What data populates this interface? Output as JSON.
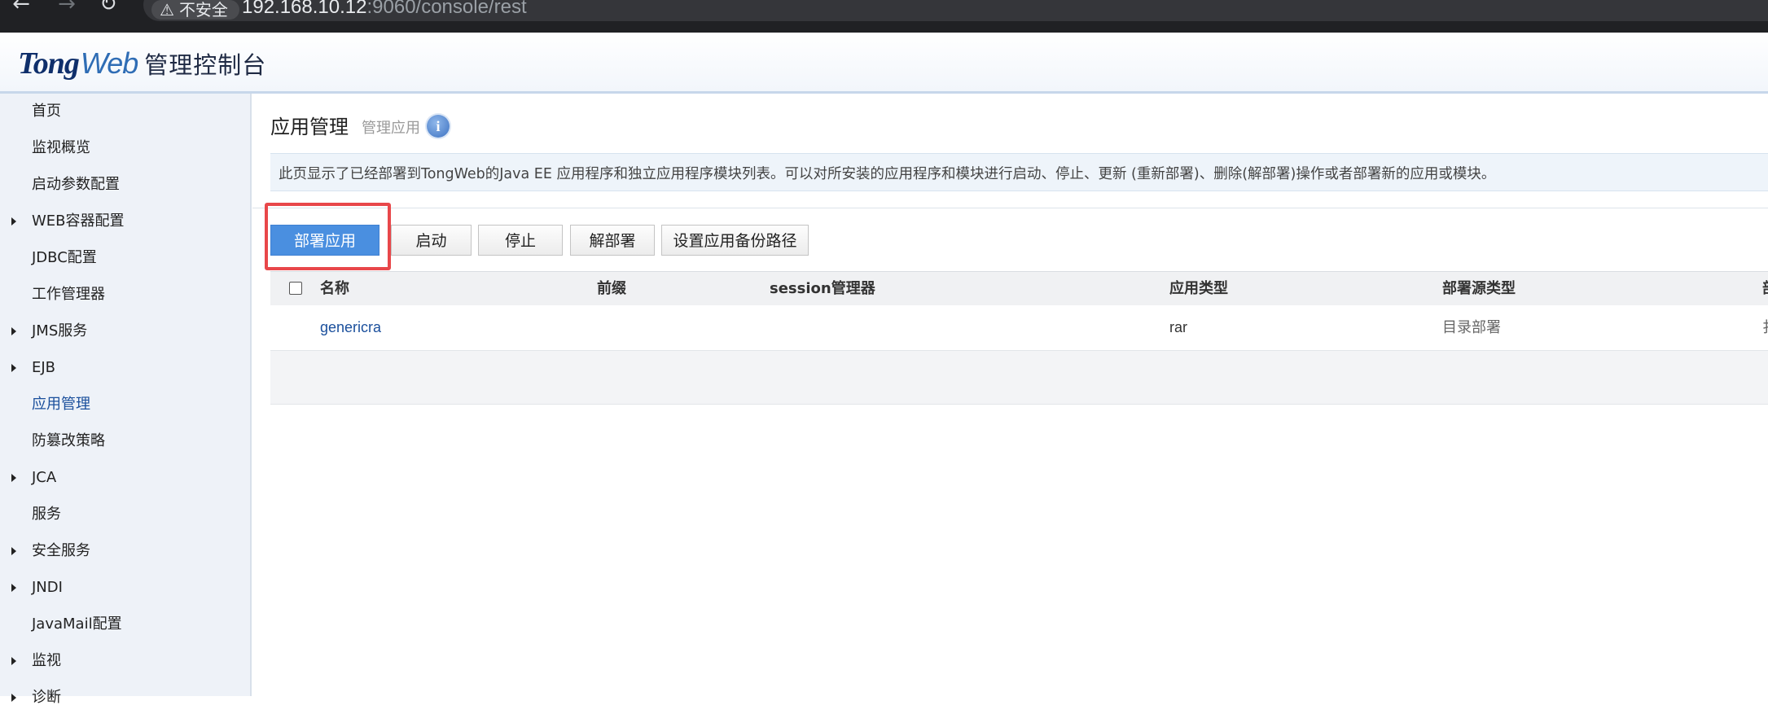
{
  "browser": {
    "back_icon": "←",
    "forward_icon": "→",
    "reload_icon": "↻",
    "security_icon": "⚠",
    "security_label": "不安全",
    "url_host": "192.168.10.12",
    "url_rest": ":9060/console/rest"
  },
  "header": {
    "logo_part1": "Tong",
    "logo_part2": "Web",
    "title": "管理控制台"
  },
  "sidebar": {
    "items": [
      {
        "label": "首页",
        "expandable": false,
        "active": false
      },
      {
        "label": "监视概览",
        "expandable": false,
        "active": false
      },
      {
        "label": "启动参数配置",
        "expandable": false,
        "active": false
      },
      {
        "label": "WEB容器配置",
        "expandable": true,
        "active": false
      },
      {
        "label": "JDBC配置",
        "expandable": false,
        "active": false
      },
      {
        "label": "工作管理器",
        "expandable": false,
        "active": false
      },
      {
        "label": "JMS服务",
        "expandable": true,
        "active": false
      },
      {
        "label": "EJB",
        "expandable": true,
        "active": false
      },
      {
        "label": "应用管理",
        "expandable": false,
        "active": true
      },
      {
        "label": "防篡改策略",
        "expandable": false,
        "active": false
      },
      {
        "label": "JCA",
        "expandable": true,
        "active": false
      },
      {
        "label": "服务",
        "expandable": false,
        "active": false
      },
      {
        "label": "安全服务",
        "expandable": true,
        "active": false
      },
      {
        "label": "JNDI",
        "expandable": true,
        "active": false
      },
      {
        "label": "JavaMail配置",
        "expandable": false,
        "active": false
      },
      {
        "label": "监视",
        "expandable": true,
        "active": false
      },
      {
        "label": "诊断",
        "expandable": true,
        "active": false
      }
    ]
  },
  "main": {
    "title": "应用管理",
    "subtitle": "管理应用",
    "info_icon": "i",
    "description": "此页显示了已经部署到TongWeb的Java EE 应用程序和独立应用程序模块列表。可以对所安装的应用程序和模块进行启动、停止、更新 (重新部署)、删除(解部署)操作或者部署新的应用或模块。",
    "toolbar": {
      "deploy": "部署应用",
      "start": "启动",
      "stop": "停止",
      "undeploy": "解部署",
      "backup_path": "设置应用备份路径"
    },
    "table": {
      "columns": [
        "名称",
        "前缀",
        "session管理器",
        "应用类型",
        "部署源类型",
        "部"
      ],
      "rows": [
        {
          "name": "genericra",
          "prefix": "",
          "session": "",
          "type": "rar",
          "source": "目录部署",
          "extra": "扌"
        }
      ]
    }
  },
  "colors": {
    "primary_button": "#4a8fe0",
    "highlight_border": "#e8474a",
    "link": "#1a4f9c",
    "sidebar_bg": "#eef2f8"
  }
}
